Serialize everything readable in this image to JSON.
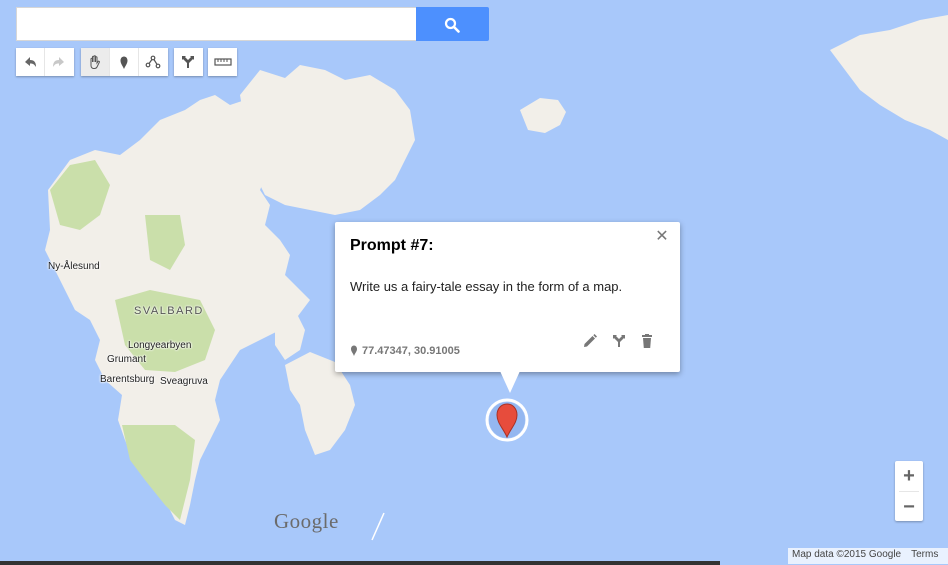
{
  "search": {
    "placeholder": "",
    "value": ""
  },
  "toolbar": {
    "history": [
      {
        "icon": "undo-icon"
      },
      {
        "icon": "redo-icon"
      }
    ],
    "tools": [
      {
        "icon": "hand-icon",
        "active": true
      },
      {
        "icon": "marker-icon",
        "active": false
      },
      {
        "icon": "line-icon",
        "active": false
      }
    ],
    "directions": {
      "icon": "directions-icon"
    },
    "measure": {
      "icon": "ruler-icon"
    }
  },
  "map": {
    "labels": {
      "ny_alesund": "Ny-Ålesund",
      "svalbard": "SVALBARD",
      "longyearbyen": "Longyearbyen",
      "grumant": "Grumant",
      "barentsburg": "Barentsburg",
      "sveagruva": "Sveagruva"
    },
    "logo": "Google",
    "colors": {
      "water": "#a8c8fa",
      "land": "#f2efe9",
      "park": "#cadfaa",
      "marker": "#e74c3c"
    }
  },
  "popup": {
    "title": "Prompt #7:",
    "body": "Write us a fairy-tale essay in the form of a map.",
    "coordinates": "77.47347, 30.91005",
    "close_symbol": "✕"
  },
  "zoom": {
    "in": "+",
    "out": "−"
  },
  "attribution": {
    "map_data": "Map data ©2015 Google",
    "terms": "Terms"
  }
}
